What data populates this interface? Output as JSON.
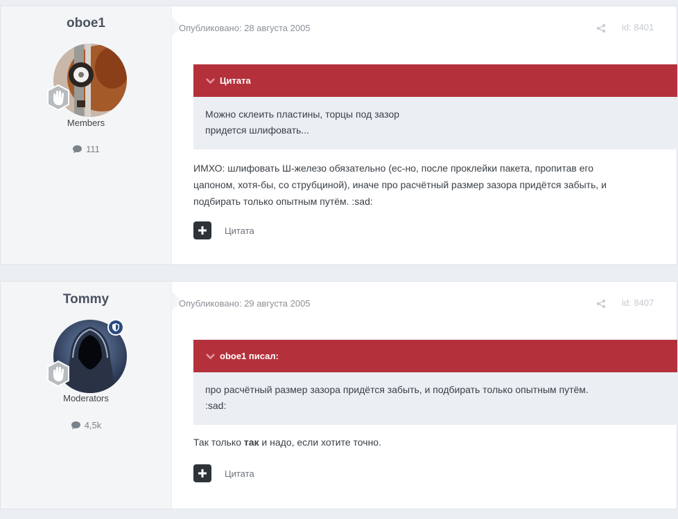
{
  "posts": [
    {
      "author": "oboe1",
      "group": "Members",
      "post_count": "111",
      "published": "Опубликовано: 28 августа 2005",
      "post_id": "id: 8401",
      "quote": {
        "header": "Цитата",
        "lines": [
          "Можно склеить пластины, торцы под зазор",
          "придется шлифовать..."
        ]
      },
      "body_lines": [
        "ИМХО: шлифовать Ш-железо обязательно (ес-но, после проклейки пакета, пропитав его",
        "цапоном, хотя-бы, со струбциной), иначе про расчётный размер зазора придётся забыть, и",
        "подбирать только опытным путём. :sad:"
      ],
      "quote_button": "Цитата"
    },
    {
      "author": "Tommy",
      "group": "Moderators",
      "post_count": "4,5k",
      "published": "Опубликовано: 29 августа 2005",
      "post_id": "id: 8407",
      "quote": {
        "header": "oboe1 писал:",
        "lines": [
          "про расчётный размер зазора придётся забыть, и подбирать только опытным путём.",
          ":sad:"
        ]
      },
      "body": {
        "before": "Так только ",
        "bold": "так",
        "after": " и надо, если хотите точно."
      },
      "quote_button": "Цитата"
    }
  ],
  "colors": {
    "quote_header": "#b4313b",
    "quote_body_bg": "#ebeef3",
    "author_panel_bg": "#f4f5f7",
    "moderator_badge": "#2b4a7e"
  },
  "icons": [
    "chevron-down-icon",
    "comment-bubble-icon",
    "share-icon",
    "plus-icon",
    "rank-hand-icon",
    "shield-icon"
  ]
}
